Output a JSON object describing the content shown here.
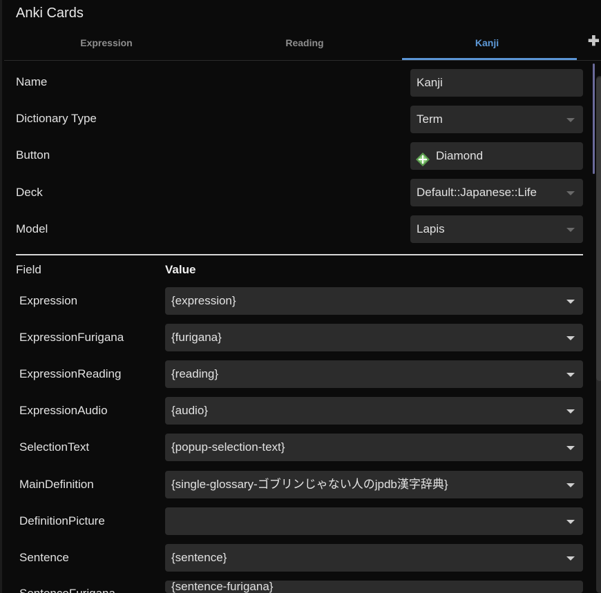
{
  "window": {
    "title": "Anki Cards"
  },
  "tabs": [
    {
      "label": "Expression",
      "active": false
    },
    {
      "label": "Reading",
      "active": false
    },
    {
      "label": "Kanji",
      "active": true
    }
  ],
  "add_tab_icon": "plus-icon",
  "properties": {
    "name": {
      "label": "Name",
      "value": "Kanji"
    },
    "dictionary_type": {
      "label": "Dictionary Type",
      "value": "Term"
    },
    "button": {
      "label": "Button",
      "value": "Diamond",
      "icon": "diamond-icon"
    },
    "deck": {
      "label": "Deck",
      "value": "Default::Japanese::Life"
    },
    "model": {
      "label": "Model",
      "value": "Lapis"
    }
  },
  "fields_table": {
    "header_field": "Field",
    "header_value": "Value",
    "rows": [
      {
        "field": "Expression",
        "value": "{expression}"
      },
      {
        "field": "ExpressionFurigana",
        "value": "{furigana}"
      },
      {
        "field": "ExpressionReading",
        "value": "{reading}"
      },
      {
        "field": "ExpressionAudio",
        "value": "{audio}"
      },
      {
        "field": "SelectionText",
        "value": "{popup-selection-text}"
      },
      {
        "field": "MainDefinition",
        "value": "{single-glossary-ゴブリンじゃない人のjpdb漢字辞典}"
      },
      {
        "field": "DefinitionPicture",
        "value": ""
      },
      {
        "field": "Sentence",
        "value": "{sentence}"
      },
      {
        "field": "SentenceFurigana",
        "value": "{sentence-furigana}"
      }
    ]
  },
  "colors": {
    "accent": "#5b95d6",
    "background": "#0b0b0b",
    "control": "#2a2a2a",
    "diamond_green": "#5a9a4e"
  }
}
